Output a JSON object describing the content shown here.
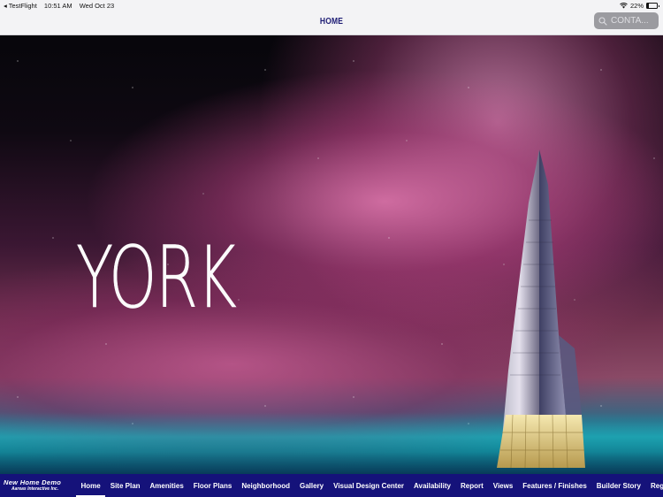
{
  "status_bar": {
    "back_app": "◂ TestFlight",
    "time": "10:51 AM",
    "date": "Wed Oct 23",
    "battery_text": "22%",
    "battery_level": 0.22
  },
  "header": {
    "title": "HOME",
    "search_placeholder": "CONTA..."
  },
  "hero": {
    "wordmark": "YORK"
  },
  "tab_bar": {
    "brand_title": "New Home Demo",
    "brand_subtitle": "Aareas Interactive Inc.",
    "active_index": 0,
    "tabs": [
      {
        "label": "Home"
      },
      {
        "label": "Site Plan"
      },
      {
        "label": "Amenities"
      },
      {
        "label": "Floor Plans"
      },
      {
        "label": "Neighborhood"
      },
      {
        "label": "Gallery"
      },
      {
        "label": "Visual Design Center"
      },
      {
        "label": "Availability"
      },
      {
        "label": "Report"
      },
      {
        "label": "Views"
      },
      {
        "label": "Features / Finishes"
      },
      {
        "label": "Builder Story"
      },
      {
        "label": "Register"
      }
    ]
  },
  "icons": {
    "wifi": "wifi-icon",
    "battery": "battery-icon",
    "search": "search-icon",
    "settings": "gear-icon"
  },
  "colors": {
    "tab_bar_bg": "#15127a",
    "header_title": "#1d1c74",
    "search_bg": "#9b9ba0"
  }
}
